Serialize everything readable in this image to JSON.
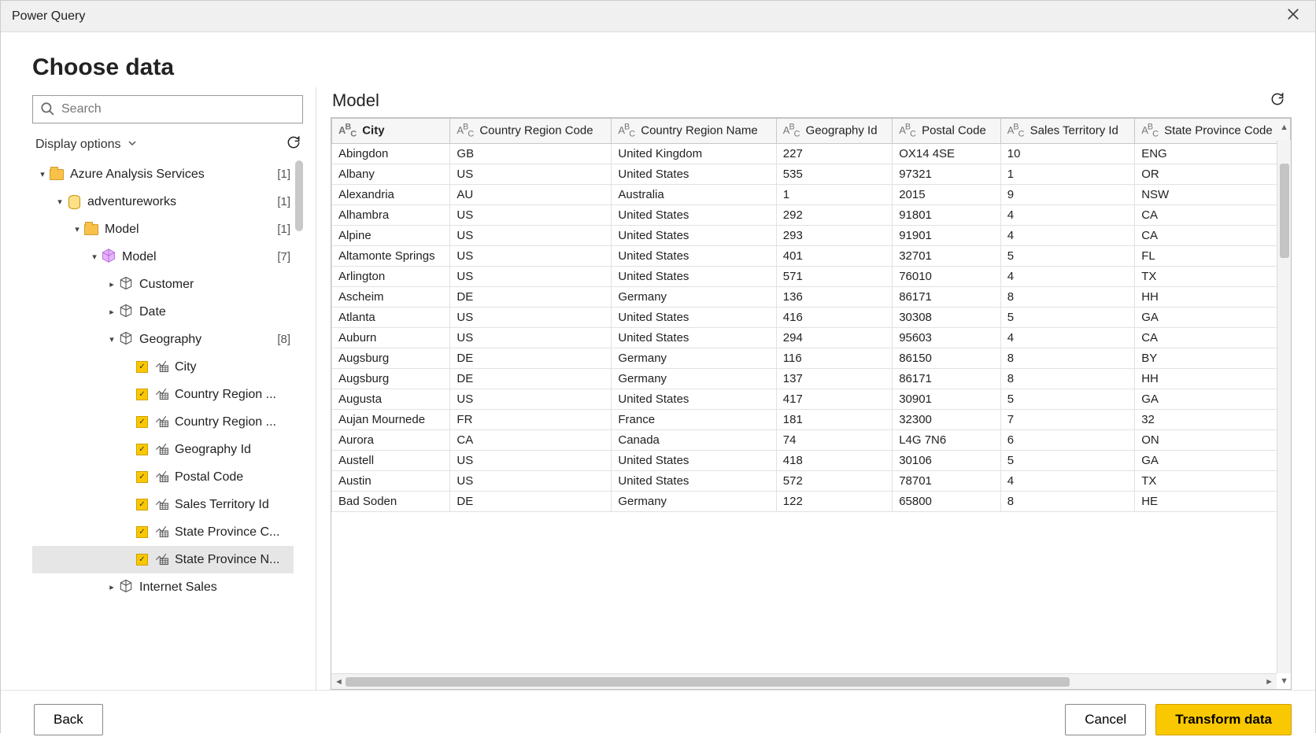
{
  "titlebar": {
    "title": "Power Query"
  },
  "header": {
    "title": "Choose data"
  },
  "search": {
    "placeholder": "Search"
  },
  "displayOptions": {
    "label": "Display options"
  },
  "tree": [
    {
      "depth": 0,
      "arrow": "down",
      "icon": "folder",
      "label": "Azure Analysis Services",
      "count": "[1]"
    },
    {
      "depth": 1,
      "arrow": "down",
      "icon": "database",
      "label": "adventureworks",
      "count": "[1]"
    },
    {
      "depth": 2,
      "arrow": "down",
      "icon": "folder",
      "label": "Model",
      "count": "[1]"
    },
    {
      "depth": 3,
      "arrow": "down",
      "icon": "cube",
      "label": "Model",
      "count": "[7]"
    },
    {
      "depth": 4,
      "arrow": "right",
      "icon": "table",
      "label": "Customer"
    },
    {
      "depth": 4,
      "arrow": "right",
      "icon": "table",
      "label": "Date"
    },
    {
      "depth": 4,
      "arrow": "down",
      "icon": "table",
      "label": "Geography",
      "count": "[8]"
    },
    {
      "depth": 5,
      "arrow": "",
      "checkbox": true,
      "icon": "column",
      "label": "City"
    },
    {
      "depth": 5,
      "arrow": "",
      "checkbox": true,
      "icon": "column",
      "label": "Country Region ..."
    },
    {
      "depth": 5,
      "arrow": "",
      "checkbox": true,
      "icon": "column",
      "label": "Country Region ..."
    },
    {
      "depth": 5,
      "arrow": "",
      "checkbox": true,
      "icon": "column",
      "label": "Geography Id"
    },
    {
      "depth": 5,
      "arrow": "",
      "checkbox": true,
      "icon": "column",
      "label": "Postal Code"
    },
    {
      "depth": 5,
      "arrow": "",
      "checkbox": true,
      "icon": "column",
      "label": "Sales Territory Id"
    },
    {
      "depth": 5,
      "arrow": "",
      "checkbox": true,
      "icon": "column",
      "label": "State Province C..."
    },
    {
      "depth": 5,
      "arrow": "",
      "checkbox": true,
      "icon": "column",
      "label": "State Province N...",
      "selected": true
    },
    {
      "depth": 4,
      "arrow": "right",
      "icon": "table",
      "label": "Internet Sales"
    }
  ],
  "preview": {
    "title": "Model",
    "columns": [
      {
        "label": "City",
        "sorted": true
      },
      {
        "label": "Country Region Code"
      },
      {
        "label": "Country Region Name"
      },
      {
        "label": "Geography Id"
      },
      {
        "label": "Postal Code"
      },
      {
        "label": "Sales Territory Id"
      },
      {
        "label": "State Province Code"
      }
    ],
    "rows": [
      [
        "Abingdon",
        "GB",
        "United Kingdom",
        "227",
        "OX14 4SE",
        "10",
        "ENG"
      ],
      [
        "Albany",
        "US",
        "United States",
        "535",
        "97321",
        "1",
        "OR"
      ],
      [
        "Alexandria",
        "AU",
        "Australia",
        "1",
        "2015",
        "9",
        "NSW"
      ],
      [
        "Alhambra",
        "US",
        "United States",
        "292",
        "91801",
        "4",
        "CA"
      ],
      [
        "Alpine",
        "US",
        "United States",
        "293",
        "91901",
        "4",
        "CA"
      ],
      [
        "Altamonte Springs",
        "US",
        "United States",
        "401",
        "32701",
        "5",
        "FL"
      ],
      [
        "Arlington",
        "US",
        "United States",
        "571",
        "76010",
        "4",
        "TX"
      ],
      [
        "Ascheim",
        "DE",
        "Germany",
        "136",
        "86171",
        "8",
        "HH"
      ],
      [
        "Atlanta",
        "US",
        "United States",
        "416",
        "30308",
        "5",
        "GA"
      ],
      [
        "Auburn",
        "US",
        "United States",
        "294",
        "95603",
        "4",
        "CA"
      ],
      [
        "Augsburg",
        "DE",
        "Germany",
        "116",
        "86150",
        "8",
        "BY"
      ],
      [
        "Augsburg",
        "DE",
        "Germany",
        "137",
        "86171",
        "8",
        "HH"
      ],
      [
        "Augusta",
        "US",
        "United States",
        "417",
        "30901",
        "5",
        "GA"
      ],
      [
        "Aujan Mournede",
        "FR",
        "France",
        "181",
        "32300",
        "7",
        "32"
      ],
      [
        "Aurora",
        "CA",
        "Canada",
        "74",
        "L4G 7N6",
        "6",
        "ON"
      ],
      [
        "Austell",
        "US",
        "United States",
        "418",
        "30106",
        "5",
        "GA"
      ],
      [
        "Austin",
        "US",
        "United States",
        "572",
        "78701",
        "4",
        "TX"
      ],
      [
        "Bad Soden",
        "DE",
        "Germany",
        "122",
        "65800",
        "8",
        "HE"
      ]
    ]
  },
  "footer": {
    "back": "Back",
    "cancel": "Cancel",
    "transform": "Transform data"
  }
}
